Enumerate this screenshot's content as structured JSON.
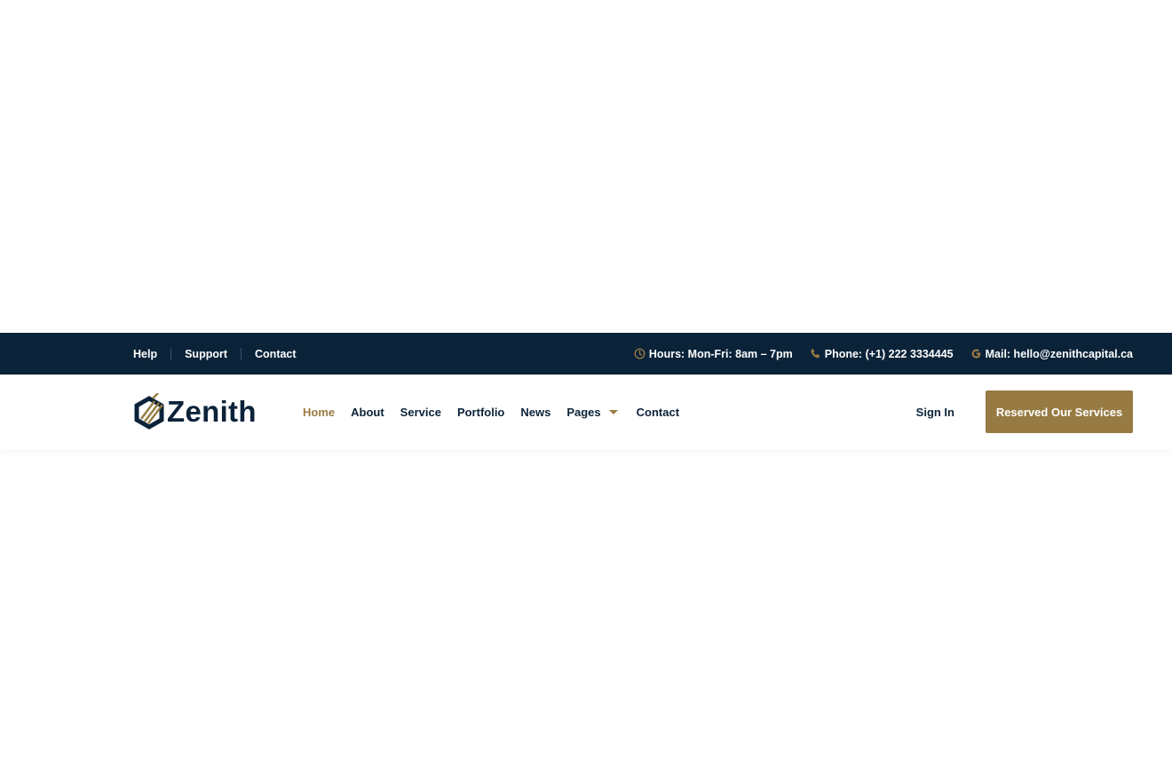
{
  "topbar": {
    "links": [
      {
        "label": "Help"
      },
      {
        "label": "Support"
      },
      {
        "label": "Contact"
      }
    ],
    "info": [
      {
        "icon": "clock-icon",
        "text": "Hours: Mon-Fri: 8am – 7pm"
      },
      {
        "icon": "phone-icon",
        "text": "Phone: (+1) 222 3334445"
      },
      {
        "icon": "google-icon",
        "text": "Mail: hello@zenithcapital.ca"
      }
    ]
  },
  "header": {
    "logo_text": "Zenith",
    "nav": [
      {
        "label": "Home",
        "active": true
      },
      {
        "label": "About"
      },
      {
        "label": "Service"
      },
      {
        "label": "Portfolio"
      },
      {
        "label": "News"
      },
      {
        "label": "Pages",
        "has_dropdown": true
      },
      {
        "label": "Contact"
      }
    ],
    "signin_label": "Sign In",
    "cta_label": "Reserved Our Services"
  },
  "colors": {
    "navy": "#0b2339",
    "gold": "#977b43",
    "white": "#ffffff"
  }
}
